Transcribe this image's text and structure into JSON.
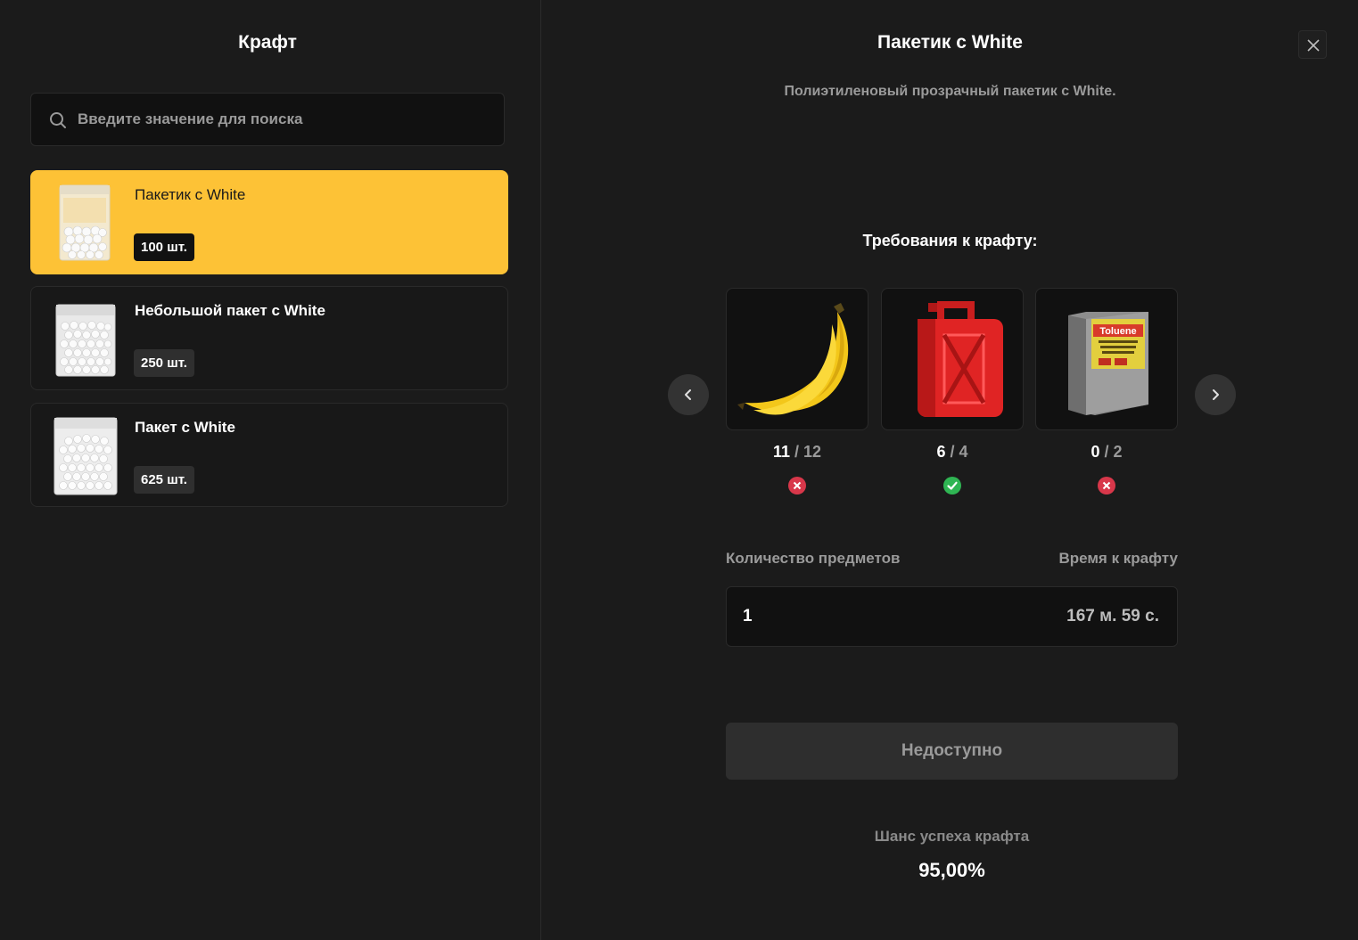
{
  "left": {
    "title": "Крафт",
    "search": {
      "placeholder": "Введите значение для поиска",
      "value": ""
    },
    "items": [
      {
        "name": "Пакетик с White",
        "count": "100 шт.",
        "selected": true
      },
      {
        "name": "Небольшой пакет с White",
        "count": "250 шт.",
        "selected": false
      },
      {
        "name": "Пакет с White",
        "count": "625 шт.",
        "selected": false
      }
    ]
  },
  "right": {
    "title": "Пакетик с White",
    "description": "Полиэтиленовый прозрачный пакетик с White.",
    "requirements_title": "Требования к крафту:",
    "requirements": [
      {
        "icon": "banana-icon",
        "have": "11",
        "need": "/ 12",
        "ok": false
      },
      {
        "icon": "jerrycan-icon",
        "have": "6",
        "need": "/ 4",
        "ok": true
      },
      {
        "icon": "toluene-icon",
        "have": "0",
        "need": "/ 2",
        "ok": false
      },
      {
        "icon_label": "Toluene"
      }
    ],
    "qty_label": "Количество предметов",
    "time_label": "Время к крафту",
    "qty_value": "1",
    "time_value": "167 м. 59 с.",
    "craft_button": "Недоступно",
    "chance_label": "Шанс успеха крафта",
    "chance_value": "95,00%"
  },
  "colors": {
    "accent": "#fdc236",
    "ok": "#2fb553",
    "fail": "#d8374a"
  }
}
